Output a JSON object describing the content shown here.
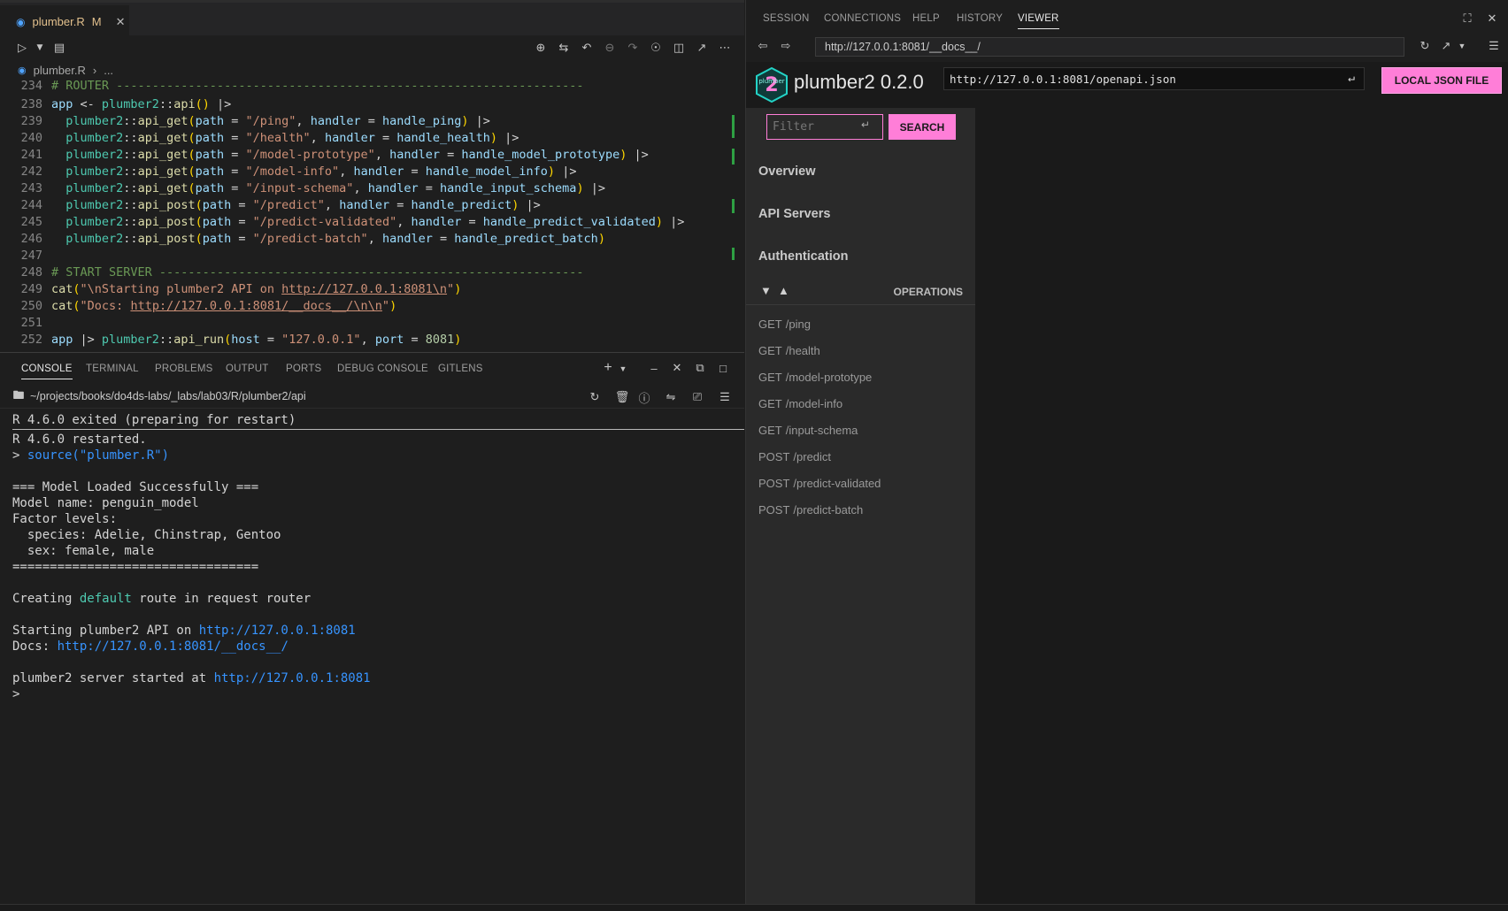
{
  "editor": {
    "tab": {
      "icon": "r-file-icon",
      "title": "plumber.R",
      "status": "M"
    },
    "breadcrumb": {
      "file": "plumber.R",
      "rest": "..."
    },
    "lines": [
      {
        "n": "234",
        "parts": [
          [
            "c",
            "# ROUTER -----------------------------------------------------------------"
          ]
        ]
      },
      {
        "n": "238",
        "parts": [
          [
            "v",
            "app"
          ],
          [
            "o",
            " <- "
          ],
          [
            "k",
            "plumber2"
          ],
          [
            "o",
            "::"
          ],
          [
            "f",
            "api"
          ],
          [
            "p",
            "()"
          ],
          [
            "o",
            " |>"
          ]
        ]
      },
      {
        "n": "239",
        "parts": [
          [
            "o",
            "  "
          ],
          [
            "k",
            "plumber2"
          ],
          [
            "o",
            "::"
          ],
          [
            "f",
            "api_get"
          ],
          [
            "p",
            "("
          ],
          [
            "v",
            "path"
          ],
          [
            "o",
            " = "
          ],
          [
            "s",
            "\"/ping\""
          ],
          [
            "o",
            ", "
          ],
          [
            "v",
            "handler"
          ],
          [
            "o",
            " = "
          ],
          [
            "v",
            "handle_ping"
          ],
          [
            "p",
            ")"
          ],
          [
            "o",
            " |>"
          ]
        ]
      },
      {
        "n": "240",
        "parts": [
          [
            "o",
            "  "
          ],
          [
            "k",
            "plumber2"
          ],
          [
            "o",
            "::"
          ],
          [
            "f",
            "api_get"
          ],
          [
            "p",
            "("
          ],
          [
            "v",
            "path"
          ],
          [
            "o",
            " = "
          ],
          [
            "s",
            "\"/health\""
          ],
          [
            "o",
            ", "
          ],
          [
            "v",
            "handler"
          ],
          [
            "o",
            " = "
          ],
          [
            "v",
            "handle_health"
          ],
          [
            "p",
            ")"
          ],
          [
            "o",
            " |>"
          ]
        ]
      },
      {
        "n": "241",
        "parts": [
          [
            "o",
            "  "
          ],
          [
            "k",
            "plumber2"
          ],
          [
            "o",
            "::"
          ],
          [
            "f",
            "api_get"
          ],
          [
            "p",
            "("
          ],
          [
            "v",
            "path"
          ],
          [
            "o",
            " = "
          ],
          [
            "s",
            "\"/model-prototype\""
          ],
          [
            "o",
            ", "
          ],
          [
            "v",
            "handler"
          ],
          [
            "o",
            " = "
          ],
          [
            "v",
            "handle_model_prototype"
          ],
          [
            "p",
            ")"
          ],
          [
            "o",
            " |>"
          ]
        ]
      },
      {
        "n": "242",
        "parts": [
          [
            "o",
            "  "
          ],
          [
            "k",
            "plumber2"
          ],
          [
            "o",
            "::"
          ],
          [
            "f",
            "api_get"
          ],
          [
            "p",
            "("
          ],
          [
            "v",
            "path"
          ],
          [
            "o",
            " = "
          ],
          [
            "s",
            "\"/model-info\""
          ],
          [
            "o",
            ", "
          ],
          [
            "v",
            "handler"
          ],
          [
            "o",
            " = "
          ],
          [
            "v",
            "handle_model_info"
          ],
          [
            "p",
            ")"
          ],
          [
            "o",
            " |>"
          ]
        ]
      },
      {
        "n": "243",
        "parts": [
          [
            "o",
            "  "
          ],
          [
            "k",
            "plumber2"
          ],
          [
            "o",
            "::"
          ],
          [
            "f",
            "api_get"
          ],
          [
            "p",
            "("
          ],
          [
            "v",
            "path"
          ],
          [
            "o",
            " = "
          ],
          [
            "s",
            "\"/input-schema\""
          ],
          [
            "o",
            ", "
          ],
          [
            "v",
            "handler"
          ],
          [
            "o",
            " = "
          ],
          [
            "v",
            "handle_input_schema"
          ],
          [
            "p",
            ")"
          ],
          [
            "o",
            " |>"
          ]
        ]
      },
      {
        "n": "244",
        "parts": [
          [
            "o",
            "  "
          ],
          [
            "k",
            "plumber2"
          ],
          [
            "o",
            "::"
          ],
          [
            "f",
            "api_post"
          ],
          [
            "p",
            "("
          ],
          [
            "v",
            "path"
          ],
          [
            "o",
            " = "
          ],
          [
            "s",
            "\"/predict\""
          ],
          [
            "o",
            ", "
          ],
          [
            "v",
            "handler"
          ],
          [
            "o",
            " = "
          ],
          [
            "v",
            "handle_predict"
          ],
          [
            "p",
            ")"
          ],
          [
            "o",
            " |>"
          ]
        ]
      },
      {
        "n": "245",
        "parts": [
          [
            "o",
            "  "
          ],
          [
            "k",
            "plumber2"
          ],
          [
            "o",
            "::"
          ],
          [
            "f",
            "api_post"
          ],
          [
            "p",
            "("
          ],
          [
            "v",
            "path"
          ],
          [
            "o",
            " = "
          ],
          [
            "s",
            "\"/predict-validated\""
          ],
          [
            "o",
            ", "
          ],
          [
            "v",
            "handler"
          ],
          [
            "o",
            " = "
          ],
          [
            "v",
            "handle_predict_validated"
          ],
          [
            "p",
            ")"
          ],
          [
            "o",
            " |>"
          ]
        ]
      },
      {
        "n": "246",
        "parts": [
          [
            "o",
            "  "
          ],
          [
            "k",
            "plumber2"
          ],
          [
            "o",
            "::"
          ],
          [
            "f",
            "api_post"
          ],
          [
            "p",
            "("
          ],
          [
            "v",
            "path"
          ],
          [
            "o",
            " = "
          ],
          [
            "s",
            "\"/predict-batch\""
          ],
          [
            "o",
            ", "
          ],
          [
            "v",
            "handler"
          ],
          [
            "o",
            " = "
          ],
          [
            "v",
            "handle_predict_batch"
          ],
          [
            "p",
            ")"
          ]
        ]
      },
      {
        "n": "247",
        "parts": []
      },
      {
        "n": "248",
        "parts": [
          [
            "c",
            "# START SERVER -----------------------------------------------------------"
          ]
        ]
      },
      {
        "n": "249",
        "parts": [
          [
            "f",
            "cat"
          ],
          [
            "p",
            "("
          ],
          [
            "s",
            "\"\\nStarting plumber2 API on "
          ],
          [
            "su",
            "http://127.0.0.1:8081\\n"
          ],
          [
            "s",
            "\""
          ],
          [
            "p",
            ")"
          ]
        ]
      },
      {
        "n": "250",
        "parts": [
          [
            "f",
            "cat"
          ],
          [
            "p",
            "("
          ],
          [
            "s",
            "\"Docs: "
          ],
          [
            "su",
            "http://127.0.0.1:8081/__docs__/\\n\\n"
          ],
          [
            "s",
            "\""
          ],
          [
            "p",
            ")"
          ]
        ]
      },
      {
        "n": "251",
        "parts": []
      },
      {
        "n": "252",
        "parts": [
          [
            "v",
            "app"
          ],
          [
            "o",
            " |> "
          ],
          [
            "k",
            "plumber2"
          ],
          [
            "o",
            "::"
          ],
          [
            "f",
            "api_run"
          ],
          [
            "p",
            "("
          ],
          [
            "v",
            "host"
          ],
          [
            "o",
            " = "
          ],
          [
            "s",
            "\"127.0.0.1\""
          ],
          [
            "o",
            ", "
          ],
          [
            "v",
            "port"
          ],
          [
            "o",
            " = "
          ],
          [
            "n",
            "8081"
          ],
          [
            "p",
            ")"
          ]
        ]
      }
    ]
  },
  "panel": {
    "tabs": [
      "CONSOLE",
      "TERMINAL",
      "PROBLEMS",
      "OUTPUT",
      "PORTS",
      "DEBUG CONSOLE",
      "GITLENS"
    ],
    "path": "~/projects/books/do4ds-labs/_labs/lab03/R/plumber2/api",
    "console": [
      {
        "t": "R 4.6.0 exited (preparing for restart)"
      },
      {
        "t": "R 4.6.0 restarted."
      },
      {
        "t": "> ",
        "g": "source(\"plumber.R\")"
      },
      {
        "t": ""
      },
      {
        "t": "=== Model Loaded Successfully ==="
      },
      {
        "t": "Model name: penguin_model"
      },
      {
        "t": "Factor levels:"
      },
      {
        "t": "  species: Adelie, Chinstrap, Gentoo"
      },
      {
        "t": "  sex: female, male"
      },
      {
        "t": "================================="
      },
      {
        "t": ""
      },
      {
        "t": "Creating ",
        "d": "default",
        "t2": " route in request router"
      },
      {
        "t": ""
      },
      {
        "t": "Starting plumber2 API on ",
        "l": "http://127.0.0.1:8081"
      },
      {
        "t": "Docs: ",
        "l": "http://127.0.0.1:8081/__docs__/"
      },
      {
        "t": ""
      },
      {
        "t": "plumber2 server started at ",
        "l": "http://127.0.0.1:8081"
      },
      {
        "t": ">"
      }
    ]
  },
  "viewer": {
    "tabs": [
      "SESSION",
      "CONNECTIONS",
      "HELP",
      "HISTORY",
      "VIEWER"
    ],
    "active_tab": "VIEWER",
    "url": "http://127.0.0.1:8081/__docs__/",
    "docs": {
      "title": "plumber2 0.2.0",
      "logo_text": "plumber",
      "spec_url": "http://127.0.0.1:8081/openapi.json",
      "json_button": "LOCAL JSON FILE",
      "filter_placeholder": "Filter",
      "search_button": "SEARCH",
      "sections": [
        "Overview",
        "API Servers",
        "Authentication"
      ],
      "operations_label": "OPERATIONS",
      "operations": [
        {
          "method": "GET",
          "path": "/ping"
        },
        {
          "method": "GET",
          "path": "/health"
        },
        {
          "method": "GET",
          "path": "/model-prototype"
        },
        {
          "method": "GET",
          "path": "/model-info"
        },
        {
          "method": "GET",
          "path": "/input-schema"
        },
        {
          "method": "POST",
          "path": "/predict"
        },
        {
          "method": "POST",
          "path": "/predict-validated"
        },
        {
          "method": "POST",
          "path": "/predict-batch"
        }
      ]
    }
  },
  "colors": {
    "accent": "#ff7ed8",
    "link": "#3794ff",
    "background": "#1e1e1e"
  }
}
